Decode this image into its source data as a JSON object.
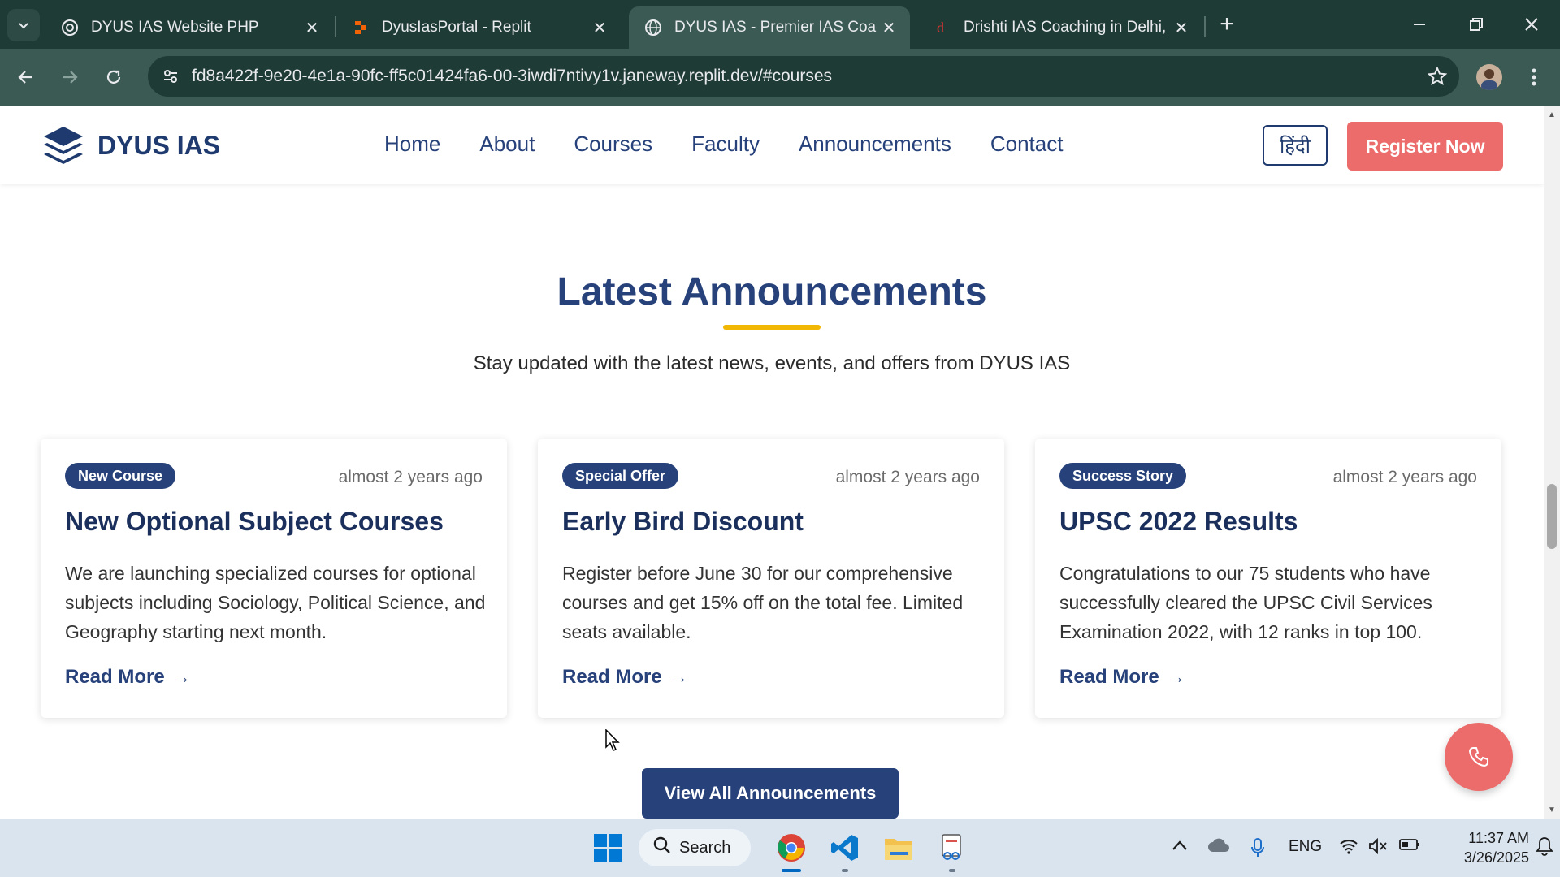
{
  "browser": {
    "tabs": [
      {
        "title": "DYUS IAS Website PHP",
        "active": false
      },
      {
        "title": "DyusIasPortal - Replit",
        "active": false
      },
      {
        "title": "DYUS IAS - Premier IAS Coachin",
        "active": true
      },
      {
        "title": "Drishti IAS Coaching in Delhi, Be",
        "active": false
      }
    ],
    "url": "fd8a422f-9e20-4e1a-90fc-ff5c01424fa6-00-3iwdi7ntivy1v.janeway.replit.dev/#courses"
  },
  "site": {
    "logo_text": "DYUS IAS",
    "nav": [
      "Home",
      "About",
      "Courses",
      "Faculty",
      "Announcements",
      "Contact"
    ],
    "lang_button": "हिंदी",
    "register_button": "Register Now"
  },
  "section": {
    "title": "Latest Announcements",
    "subtitle": "Stay updated with the latest news, events, and offers from DYUS IAS",
    "view_all_button": "View All Announcements"
  },
  "announcements": [
    {
      "badge": "New Course",
      "date": "almost 2 years ago",
      "title": "New Optional Subject Courses",
      "body": "We are launching specialized courses for optional subjects including Sociology, Political Science, and Geography starting next month.",
      "link": "Read More"
    },
    {
      "badge": "Special Offer",
      "date": "almost 2 years ago",
      "title": "Early Bird Discount",
      "body": "Register before June 30 for our comprehensive courses and get 15% off on the total fee. Limited seats available.",
      "link": "Read More"
    },
    {
      "badge": "Success Story",
      "date": "almost 2 years ago",
      "title": "UPSC 2022 Results",
      "body": "Congratulations to our 75 students who have successfully cleared the UPSC Civil Services Examination 2022, with 12 ranks in top 100.",
      "link": "Read More"
    }
  ],
  "taskbar": {
    "search_label": "Search",
    "lang": "ENG",
    "time": "11:37 AM",
    "date": "3/26/2025"
  },
  "colors": {
    "brand_navy": "#27417a",
    "accent_coral": "#ec6b6b",
    "accent_yellow": "#f2b705",
    "chrome_dark": "#1f3b35"
  }
}
